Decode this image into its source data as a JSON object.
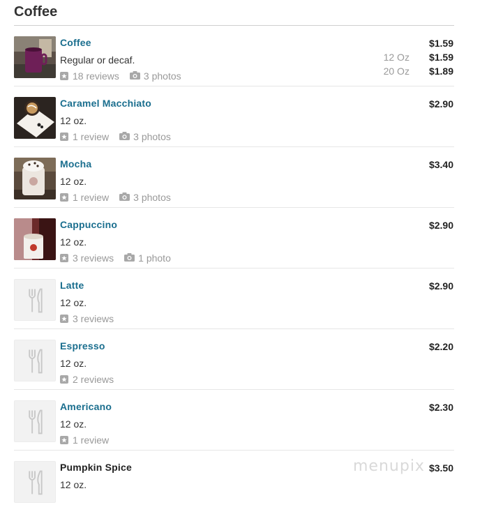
{
  "section": {
    "title": "Coffee"
  },
  "items": [
    {
      "name": "Coffee",
      "desc": "Regular or decaf.",
      "price": "$1.59",
      "reviews": "18 reviews",
      "photos": "3 photos",
      "linked": true,
      "sizes": [
        {
          "label": "12 Oz",
          "price": "$1.59"
        },
        {
          "label": "20 Oz",
          "price": "$1.89"
        }
      ]
    },
    {
      "name": "Caramel Macchiato",
      "desc": "12 oz.",
      "price": "$2.90",
      "reviews": "1 review",
      "photos": "3 photos",
      "linked": true
    },
    {
      "name": "Mocha",
      "desc": "12 oz.",
      "price": "$3.40",
      "reviews": "1 review",
      "photos": "3 photos",
      "linked": true
    },
    {
      "name": "Cappuccino",
      "desc": "12 oz.",
      "price": "$2.90",
      "reviews": "3 reviews",
      "photos": "1 photo",
      "linked": true
    },
    {
      "name": "Latte",
      "desc": "12 oz.",
      "price": "$2.90",
      "reviews": "3 reviews",
      "photos": null,
      "linked": true
    },
    {
      "name": "Espresso",
      "desc": "12 oz.",
      "price": "$2.20",
      "reviews": "2 reviews",
      "photos": null,
      "linked": true
    },
    {
      "name": "Americano",
      "desc": "12 oz.",
      "price": "$2.30",
      "reviews": "1 review",
      "photos": null,
      "linked": true
    },
    {
      "name": "Pumpkin Spice",
      "desc": "12 oz.",
      "price": "$3.50",
      "reviews": null,
      "photos": null,
      "linked": false
    }
  ],
  "icons": {
    "review": "star-icon",
    "photo": "camera-icon",
    "placeholder": "fork-knife-icon"
  },
  "colors": {
    "link": "#1a6e8e",
    "muted": "#999999"
  },
  "watermark": "menupix"
}
